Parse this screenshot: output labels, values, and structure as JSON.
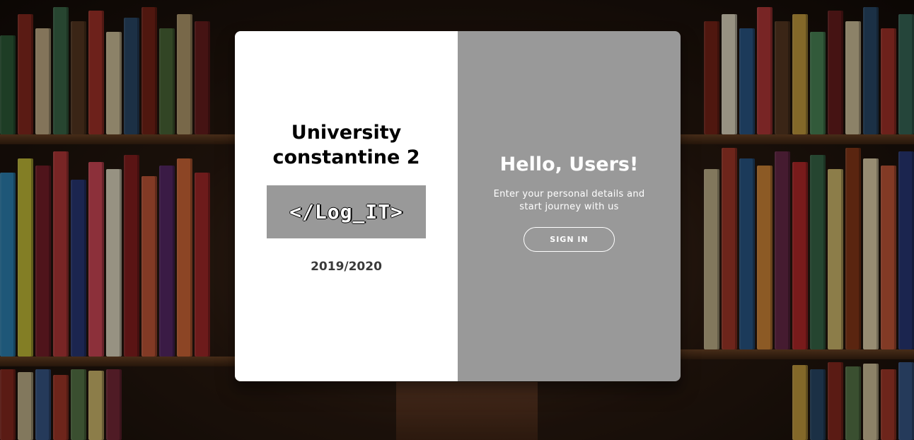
{
  "left_panel": {
    "title": "University constantine 2",
    "logo_text": "</Log_IT>",
    "year": "2019/2020"
  },
  "right_panel": {
    "heading": "Hello, Users!",
    "subtext": "Enter your personal details and start journey with us",
    "signin_label": "SIGN IN"
  },
  "colors": {
    "left_panel_bg": "#ffffff",
    "right_panel_bg": "#999999",
    "logo_box_bg": "#999999",
    "text_dark": "#000000",
    "text_light": "#ffffff"
  },
  "background": {
    "image": "library-bookshelves-photo"
  }
}
